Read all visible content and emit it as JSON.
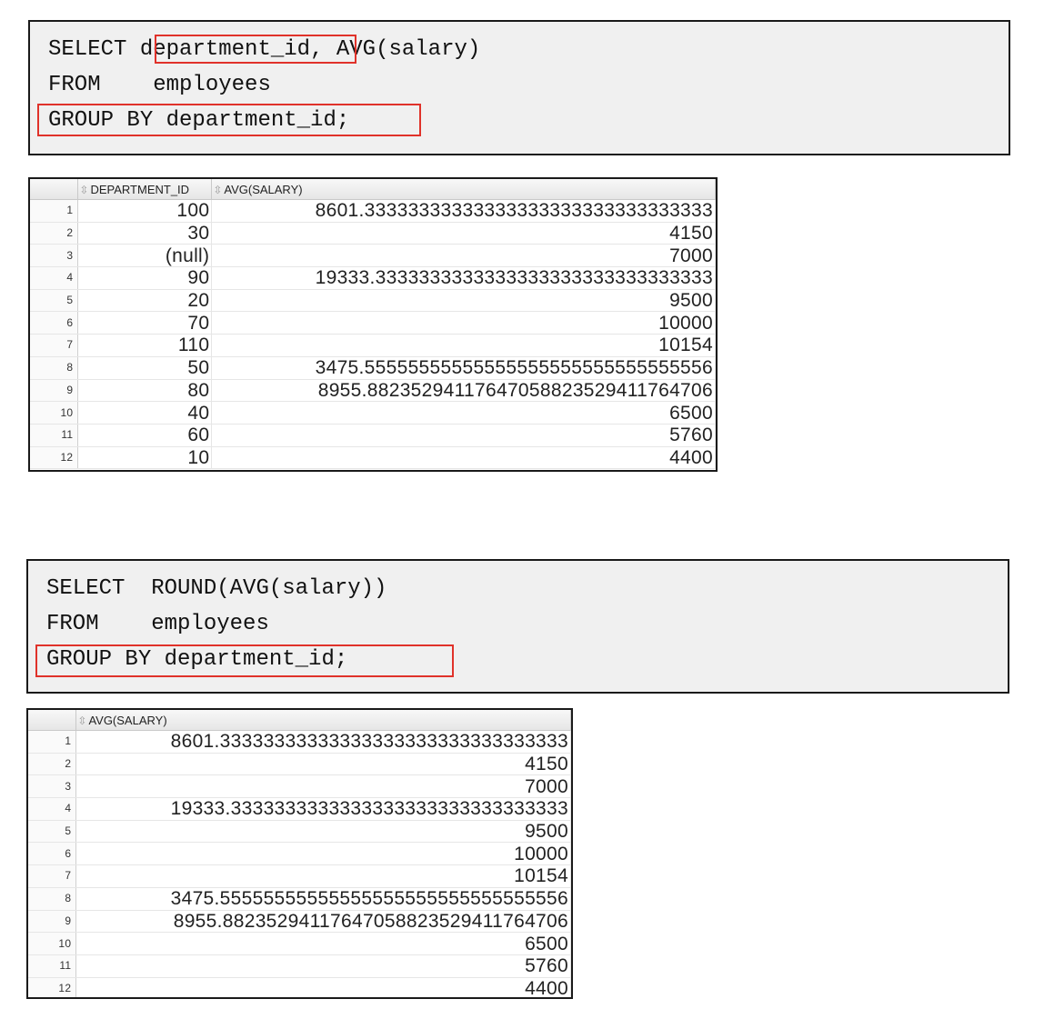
{
  "query1": {
    "lines": [
      [
        "SELECT ",
        "department_id",
        ", AVG(salary)"
      ],
      [
        "FROM    employees"
      ],
      [
        "GROUP BY department_id;"
      ]
    ]
  },
  "result1": {
    "columns": [
      "DEPARTMENT_ID",
      "AVG(SALARY)"
    ],
    "rows": [
      [
        "1",
        "100",
        "8601.33333333333333333333333333333333"
      ],
      [
        "2",
        "30",
        "4150"
      ],
      [
        "3",
        "(null)",
        "7000"
      ],
      [
        "4",
        "90",
        "19333.3333333333333333333333333333333"
      ],
      [
        "5",
        "20",
        "9500"
      ],
      [
        "6",
        "70",
        "10000"
      ],
      [
        "7",
        "110",
        "10154"
      ],
      [
        "8",
        "50",
        "3475.55555555555555555555555555555556"
      ],
      [
        "9",
        "80",
        "8955.88235294117647058823529411764706"
      ],
      [
        "10",
        "40",
        "6500"
      ],
      [
        "11",
        "60",
        "5760"
      ],
      [
        "12",
        "10",
        "4400"
      ]
    ]
  },
  "query2": {
    "lines": [
      [
        "SELECT  ROUND(AVG(salary))"
      ],
      [
        "FROM    employees"
      ],
      [
        "GROUP BY department_id;"
      ]
    ]
  },
  "result2": {
    "columns": [
      "AVG(SALARY)"
    ],
    "rows": [
      [
        "1",
        "8601.33333333333333333333333333333333"
      ],
      [
        "2",
        "4150"
      ],
      [
        "3",
        "7000"
      ],
      [
        "4",
        "19333.3333333333333333333333333333333"
      ],
      [
        "5",
        "9500"
      ],
      [
        "6",
        "10000"
      ],
      [
        "7",
        "10154"
      ],
      [
        "8",
        "3475.55555555555555555555555555555556"
      ],
      [
        "9",
        "8955.88235294117647058823529411764706"
      ],
      [
        "10",
        "6500"
      ],
      [
        "11",
        "5760"
      ],
      [
        "12",
        "4400"
      ]
    ]
  },
  "colors": {
    "highlight": "#e0322a",
    "code_bg": "#f0f0f0"
  },
  "icons": {
    "sort": "sort-arrows-icon"
  }
}
